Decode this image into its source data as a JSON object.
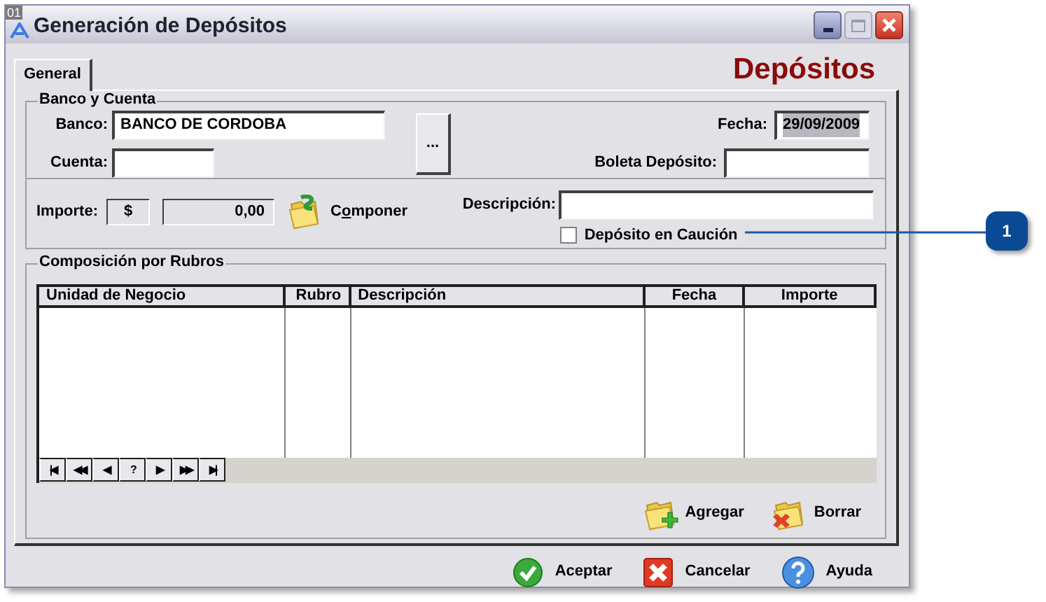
{
  "corner_label": "01",
  "window": {
    "title": "Generación de Depósitos"
  },
  "tabs": [
    {
      "label": "General",
      "selected": true
    }
  ],
  "header": "Depósitos",
  "banco_y_cuenta": {
    "title": "Banco y Cuenta",
    "banco": {
      "label": "Banco:",
      "value": "BANCO DE CORDOBA"
    },
    "cuenta": {
      "label": "Cuenta:"
    },
    "browse_button": "...",
    "fecha": {
      "label": "Fecha:",
      "value": "29/09/2009",
      "selected": true
    },
    "boleta": {
      "label": "Boleta Depósito:"
    }
  },
  "importe": {
    "label": "Importe:",
    "currency": "$",
    "value": "0,00"
  },
  "componer": {
    "label": "Componer"
  },
  "descripcion": {
    "label": "Descripción:"
  },
  "caucion": {
    "label": "Depósito en Caución",
    "checked": false
  },
  "rubros": {
    "title": "Composición por Rubros",
    "columns": [
      {
        "label": "Unidad de Negocio"
      },
      {
        "label": "Rubro"
      },
      {
        "label": "Descripción"
      },
      {
        "label": "Fecha"
      },
      {
        "label": "Importe"
      }
    ],
    "navigator": [
      "|◀",
      "◀◀",
      "◀",
      "?",
      "▶",
      "▶▶",
      "▶|"
    ]
  },
  "actions": [
    {
      "label": "Agregar",
      "kind": "add"
    },
    {
      "label": "Borrar",
      "kind": "delete"
    }
  ],
  "buttons": [
    {
      "label": "Aceptar",
      "kind": "ok"
    },
    {
      "label": "Cancelar",
      "kind": "cancel"
    },
    {
      "label": "Ayuda",
      "kind": "help"
    }
  ],
  "callout": "1"
}
